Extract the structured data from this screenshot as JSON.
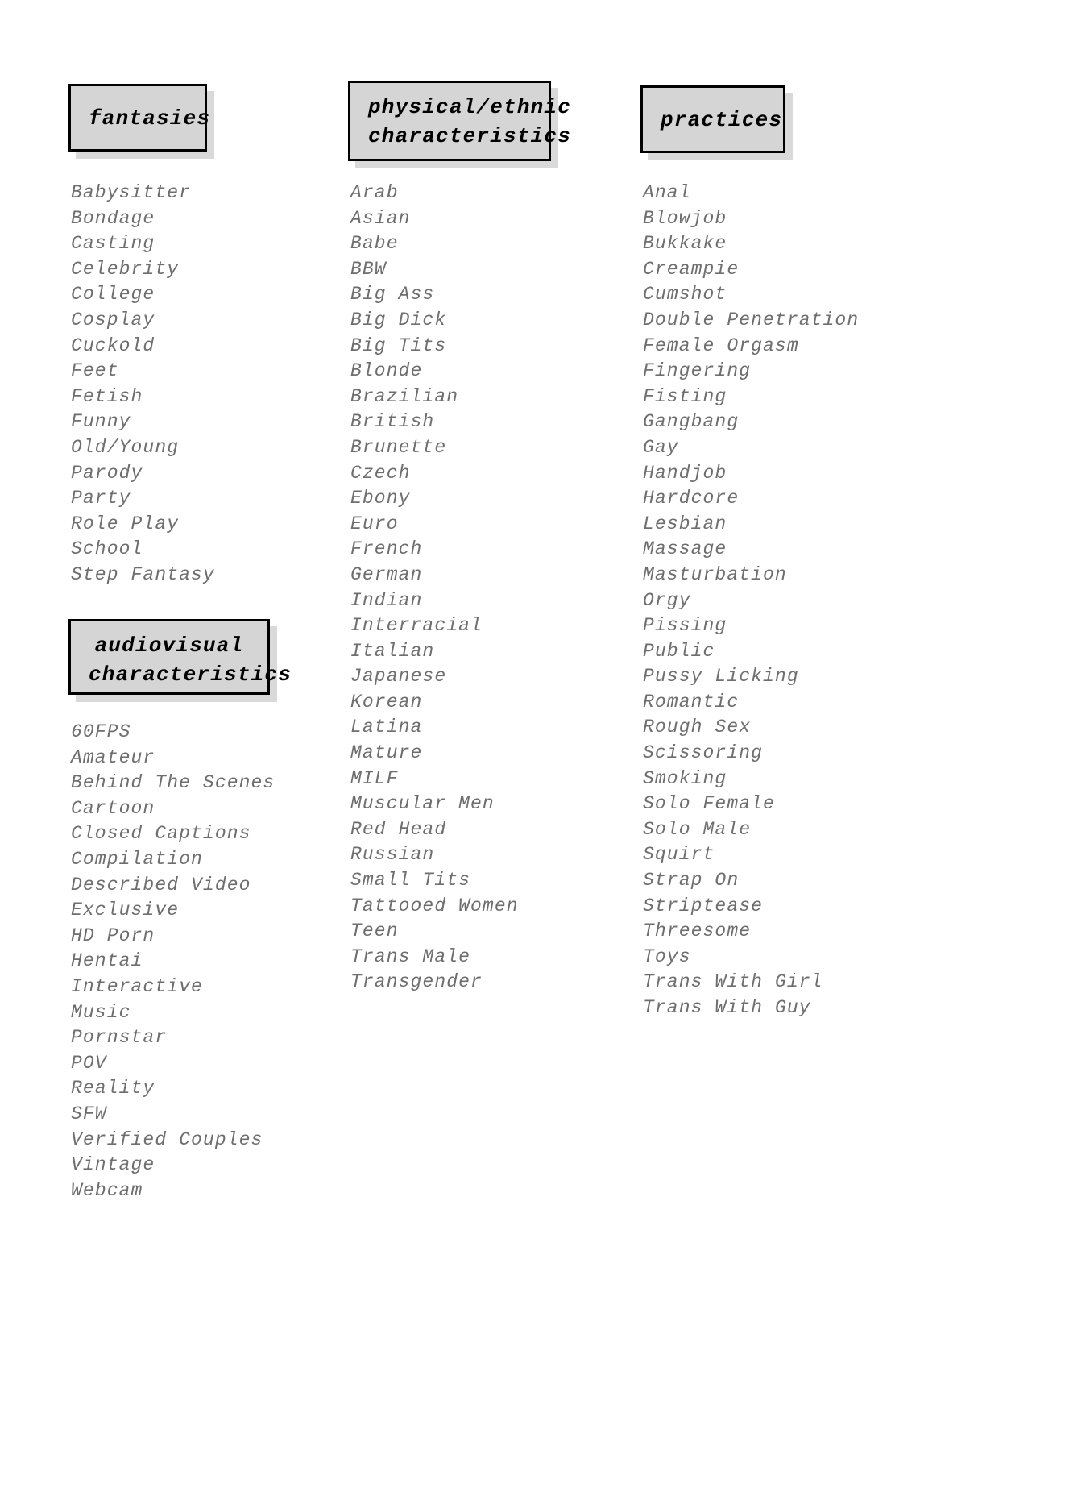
{
  "document": {
    "background_color": "#ffffff",
    "header_fill_color": "#d5d5d5",
    "header_border_color": "#000000",
    "header_shadow_color": "#d9d9d9",
    "header_text_color": "#000000",
    "item_text_color": "#6e6e6e"
  },
  "sections": {
    "fantasies": {
      "title": "fantasies",
      "items": [
        "Babysitter",
        "Bondage",
        "Casting",
        "Celebrity",
        "College",
        "Cosplay",
        "Cuckold",
        "Feet",
        "Fetish",
        "Funny",
        "Old/Young",
        "Parody",
        "Party",
        "Role Play",
        "School",
        "Step Fantasy"
      ]
    },
    "audiovisual": {
      "title": "audiovisual\ncharacteristics",
      "items": [
        "60FPS",
        "Amateur",
        "Behind The Scenes",
        "Cartoon",
        "Closed Captions",
        "Compilation",
        "Described Video",
        "Exclusive",
        "HD Porn",
        "Hentai",
        "Interactive",
        "Music",
        "Pornstar",
        "POV",
        "Reality",
        "SFW",
        "Verified Couples",
        "Vintage",
        "Webcam"
      ]
    },
    "physical": {
      "title": "physical/ethnic\ncharacteristics",
      "items": [
        "Arab",
        "Asian",
        "Babe",
        "BBW",
        "Big Ass",
        "Big Dick",
        "Big Tits",
        "Blonde",
        "Brazilian",
        "British",
        "Brunette",
        "Czech",
        "Ebony",
        "Euro",
        "French",
        "German",
        "Indian",
        "Interracial",
        "Italian",
        "Japanese",
        "Korean",
        "Latina",
        "Mature",
        "MILF",
        "Muscular Men",
        "Red Head",
        "Russian",
        "Small Tits",
        "Tattooed Women",
        "Teen",
        "Trans Male",
        "Transgender"
      ]
    },
    "practices": {
      "title": "practices",
      "items": [
        "Anal",
        "Blowjob",
        "Bukkake",
        "Creampie",
        "Cumshot",
        "Double Penetration",
        "Female Orgasm",
        "Fingering",
        "Fisting",
        "Gangbang",
        "Gay",
        "Handjob",
        "Hardcore",
        "Lesbian",
        "Massage",
        "Masturbation",
        "Orgy",
        "Pissing",
        "Public",
        "Pussy Licking",
        "Romantic",
        "Rough Sex",
        "Scissoring",
        "Smoking",
        "Solo Female",
        "Solo Male",
        "Squirt",
        "Strap On",
        "Striptease",
        "Threesome",
        "Toys",
        "Trans With Girl",
        "Trans With Guy"
      ]
    }
  }
}
